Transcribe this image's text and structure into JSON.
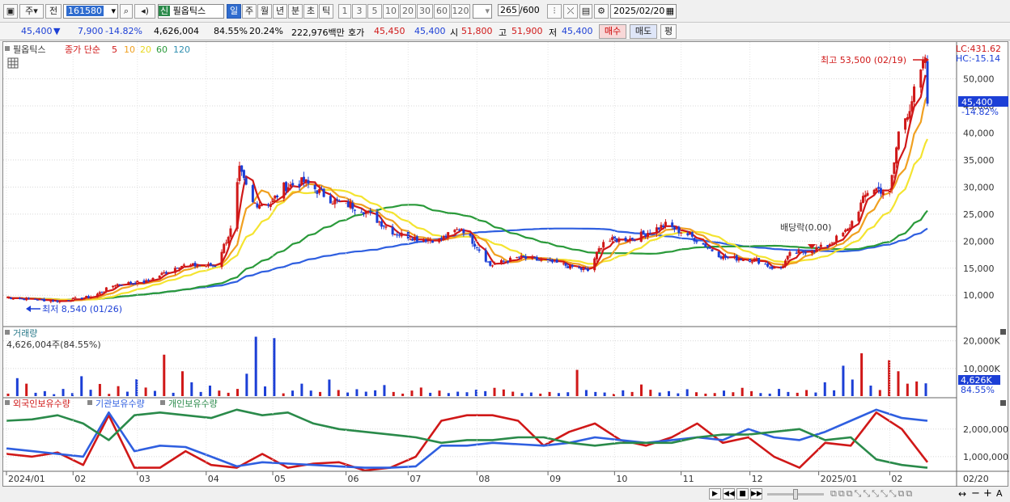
{
  "toolbar": {
    "market": "주",
    "prev": "전",
    "code": "161580",
    "name_tag": "신",
    "name": "필옵틱스",
    "periods": [
      "일",
      "주",
      "월",
      "년",
      "분",
      "초",
      "틱"
    ],
    "minutes": [
      "1",
      "3",
      "5",
      "10",
      "20",
      "30",
      "60",
      "120"
    ],
    "count": "265",
    "count_total": "/600",
    "date": "2025/02/20"
  },
  "quote": {
    "price": "45,400",
    "arrow": "▼",
    "change": "7,900",
    "change_pct": "-14.82%",
    "volume": "4,626,004",
    "vol_pct": "84.55%",
    "turnover": "20.24%",
    "amount": "222,976백만",
    "bid_label": "호가",
    "bid1": "45,450",
    "bid2": "45,400",
    "open_label": "시",
    "open": "51,800",
    "high_label": "고",
    "high": "51,900",
    "low_label": "저",
    "low": "45,400",
    "buy": "매수",
    "sell": "매도",
    "avg": "평"
  },
  "price_panel": {
    "legend_name": "필옵틱스",
    "legend_type": "종가 단순",
    "ma_labels": [
      "5",
      "10",
      "20",
      "60",
      "120"
    ],
    "lc": "LC:431.62",
    "hc": "HC:-15.14",
    "last_price": "45,400",
    "last_pct": "-14.82%",
    "high_annot": "최고 53,500 (02/19)",
    "low_annot": "최저 8,540 (01/26)",
    "dividend_annot": "배당락(0.00)"
  },
  "volume_panel": {
    "title": "거래량",
    "value": "4,626,004주(84.55%)",
    "last": "4,626K",
    "last_pct": "84.55%"
  },
  "holdings_panel": {
    "labels": [
      "외국인보유수량",
      "기관보유수량",
      "개인보유수량"
    ]
  },
  "colors": {
    "up": "#d01818",
    "down": "#1c3fd6",
    "ma5": "#d01818",
    "ma10": "#f0a020",
    "ma20": "#f4e430",
    "ma60": "#2a9a3a",
    "ma120": "#2f5fe0",
    "foreign": "#d01818",
    "inst": "#2f5fe0",
    "retail": "#2a8a4a"
  },
  "chart_data": [
    {
      "type": "candlestick",
      "title": "필옵틱스",
      "y_ticks": [
        "10,000",
        "15,000",
        "20,000",
        "25,000",
        "30,000",
        "35,000",
        "40,000",
        "45,000",
        "50,000"
      ],
      "y_range": [
        6000,
        55000
      ],
      "x_ticks": [
        "2024/01",
        "02",
        "03",
        "04",
        "05",
        "06",
        "07",
        "08",
        "09",
        "10",
        "11",
        "12",
        "2025/01",
        "02",
        "02/20"
      ],
      "close_points": [
        [
          "2024-01-02",
          9600
        ],
        [
          "2024-01-26",
          8900
        ],
        [
          "2024-02-10",
          9800
        ],
        [
          "2024-02-20",
          12000
        ],
        [
          "2024-03-05",
          12500
        ],
        [
          "2024-03-20",
          15500
        ],
        [
          "2024-04-05",
          15500
        ],
        [
          "2024-04-12",
          22000
        ],
        [
          "2024-04-16",
          33000
        ],
        [
          "2024-04-22",
          27000
        ],
        [
          "2024-04-30",
          27000
        ],
        [
          "2024-05-06",
          30000
        ],
        [
          "2024-05-15",
          31000
        ],
        [
          "2024-05-28",
          27500
        ],
        [
          "2024-06-10",
          26000
        ],
        [
          "2024-06-25",
          21500
        ],
        [
          "2024-07-05",
          20500
        ],
        [
          "2024-07-15",
          20200
        ],
        [
          "2024-07-25",
          22500
        ],
        [
          "2024-08-01",
          19000
        ],
        [
          "2024-08-07",
          15500
        ],
        [
          "2024-08-20",
          17000
        ],
        [
          "2024-09-05",
          16000
        ],
        [
          "2024-09-20",
          14500
        ],
        [
          "2024-09-27",
          20000
        ],
        [
          "2024-10-10",
          20500
        ],
        [
          "2024-10-25",
          23000
        ],
        [
          "2024-11-05",
          21000
        ],
        [
          "2024-11-20",
          17000
        ],
        [
          "2024-12-05",
          16500
        ],
        [
          "2024-12-15",
          14500
        ],
        [
          "2024-12-20",
          17500
        ],
        [
          "2025-01-05",
          19000
        ],
        [
          "2025-01-15",
          22000
        ],
        [
          "2025-01-25",
          30000
        ],
        [
          "2025-02-03",
          29000
        ],
        [
          "2025-02-07",
          40000
        ],
        [
          "2025-02-12",
          45000
        ],
        [
          "2025-02-19",
          53300
        ],
        [
          "2025-02-20",
          45400
        ]
      ],
      "ma_series": [
        {
          "name": "5"
        },
        {
          "name": "10"
        },
        {
          "name": "20"
        },
        {
          "name": "60"
        },
        {
          "name": "120"
        }
      ]
    },
    {
      "type": "bar",
      "title": "거래량",
      "y_ticks": [
        "10,000K",
        "20,000K"
      ],
      "y_range": [
        0,
        24000
      ],
      "values_k": [
        900,
        6500,
        4500,
        1200,
        1800,
        700,
        2600,
        1100,
        7200,
        2300,
        4400,
        800,
        3600,
        1600,
        6100,
        3100,
        1900,
        15000,
        1200,
        9000,
        5000,
        1500,
        3800,
        2000,
        1200,
        2600,
        8100,
        21500,
        3500,
        21000,
        1000,
        2000,
        4500,
        2000,
        1500,
        6000,
        2200,
        1300,
        2500,
        1600,
        2100,
        4000,
        1500,
        900,
        2000,
        3100,
        1200,
        2000,
        1100,
        1600,
        1400,
        2300,
        1800,
        3000,
        2400,
        1600,
        1100,
        1300,
        900,
        1500,
        1100,
        1400,
        9500,
        2200,
        1500,
        1300,
        800,
        2100,
        1500,
        4200,
        2300,
        1300,
        1800,
        1000,
        2500,
        1400,
        900,
        1100,
        2000,
        1400,
        3000,
        1800,
        1100,
        900,
        2600,
        1500,
        1200,
        2200,
        1300,
        5000,
        2100,
        11000,
        6000,
        15500,
        3800,
        2200,
        13000,
        9000,
        4500,
        5300,
        4626
      ]
    },
    {
      "type": "line",
      "title": "외국인보유수량 / 기관보유수량 / 개인보유수량",
      "y_ticks": [
        "1,000,000",
        "2,000,000"
      ],
      "series": [
        {
          "name": "외국인보유수량",
          "values": [
            1100000,
            1000000,
            1150000,
            700000,
            2500000,
            600000,
            600000,
            1200000,
            700000,
            600000,
            1100000,
            600000,
            750000,
            800000,
            500000,
            600000,
            1000000,
            2300000,
            2500000,
            2500000,
            2300000,
            1400000,
            1900000,
            2200000,
            1600000,
            1400000,
            1700000,
            2200000,
            1500000,
            1700000,
            1000000,
            600000,
            1500000,
            1400000,
            2600000,
            2000000,
            800000
          ]
        },
        {
          "name": "기관보유수량",
          "values": [
            1300000,
            1200000,
            1100000,
            1000000,
            2600000,
            1200000,
            1400000,
            1350000,
            1000000,
            650000,
            800000,
            750000,
            700000,
            650000,
            600000,
            600000,
            650000,
            1400000,
            1400000,
            1500000,
            1450000,
            1400000,
            1500000,
            1700000,
            1600000,
            1500000,
            1600000,
            1700000,
            1600000,
            2000000,
            1700000,
            1600000,
            1900000,
            2300000,
            2700000,
            2400000,
            2300000
          ]
        },
        {
          "name": "개인보유수량",
          "values": [
            2300000,
            2350000,
            2500000,
            2200000,
            1600000,
            2500000,
            2600000,
            2500000,
            2400000,
            2700000,
            2500000,
            2600000,
            2200000,
            2000000,
            1900000,
            1800000,
            1700000,
            1500000,
            1600000,
            1600000,
            1700000,
            1700000,
            1500000,
            1400000,
            1500000,
            1500000,
            1500000,
            1700000,
            1800000,
            1800000,
            1900000,
            2000000,
            1600000,
            1700000,
            900000,
            700000,
            600000
          ]
        }
      ]
    }
  ]
}
